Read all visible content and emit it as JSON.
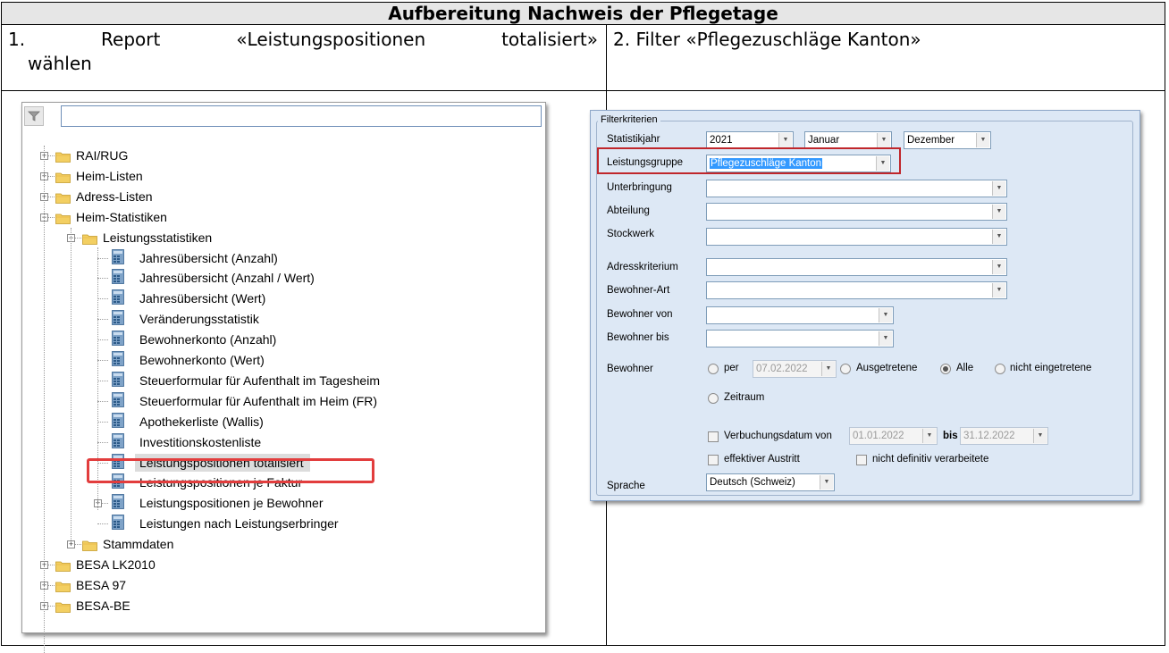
{
  "doc": {
    "title": "Aufbereitung Nachweis der Pflegetage",
    "step1": {
      "number": "1.",
      "text_a": "Report",
      "text_b": "«Leistungspositionen",
      "text_c": "totalisiert»",
      "text_d": "wählen"
    },
    "step2": "2. Filter «Pflegezuschläge Kanton»"
  },
  "tree": {
    "items": [
      "RAI/RUG",
      "Heim-Listen",
      "Adress-Listen",
      "Heim-Statistiken",
      "Leistungsstatistiken",
      "Jahresübersicht (Anzahl)",
      "Jahresübersicht (Anzahl / Wert)",
      "Jahresübersicht (Wert)",
      "Veränderungsstatistik",
      "Bewohnerkonto (Anzahl)",
      "Bewohnerkonto (Wert)",
      "Steuerformular für Aufenthalt im Tagesheim",
      "Steuerformular für Aufenthalt im Heim (FR)",
      "Apothekerliste (Wallis)",
      "Investitionskostenliste",
      "Leistungspositionen totalisiert",
      "Leistungspositionen je Faktur",
      "Leistungspositionen je Bewohner",
      "Leistungen nach Leistungserbringer",
      "Stammdaten",
      "BESA LK2010",
      "BESA 97",
      "BESA-BE"
    ],
    "icons": {
      "folder": "folder-icon",
      "report": "report-icon",
      "filter": "filter-icon"
    }
  },
  "form": {
    "group_title": "Filterkriterien",
    "labels": {
      "statistikjahr": "Statistikjahr",
      "leistungsgruppe": "Leistungsgruppe",
      "unterbringung": "Unterbringung",
      "abteilung": "Abteilung",
      "stockwerk": "Stockwerk",
      "adresskriterium": "Adresskriterium",
      "bewohner_art": "Bewohner-Art",
      "bewohner_von": "Bewohner von",
      "bewohner_bis": "Bewohner bis",
      "bewohner": "Bewohner",
      "sprache": "Sprache"
    },
    "values": {
      "jahr": "2021",
      "monat_von": "Januar",
      "monat_bis": "Dezember",
      "leistungsgruppe": "Pflegezuschläge Kanton",
      "per_date": "07.02.2022",
      "verbuchung_von": "01.01.2022",
      "verbuchung_bis": "31.12.2022",
      "sprache": "Deutsch (Schweiz)"
    },
    "radios": {
      "per": "per",
      "ausgetretene": "Ausgetretene",
      "alle": "Alle",
      "nicht_eingetretene": "nicht eingetretene",
      "zeitraum": "Zeitraum"
    },
    "checks": {
      "verbuchung": "Verbuchungsdatum von",
      "bis": "bis",
      "effektiver_austritt": "effektiver Austritt",
      "nicht_definitiv": "nicht definitiv verarbeitete"
    },
    "colors": {
      "highlight": "#e23d3d",
      "selection": "#3399ff",
      "panel": "#dde8f5"
    }
  }
}
